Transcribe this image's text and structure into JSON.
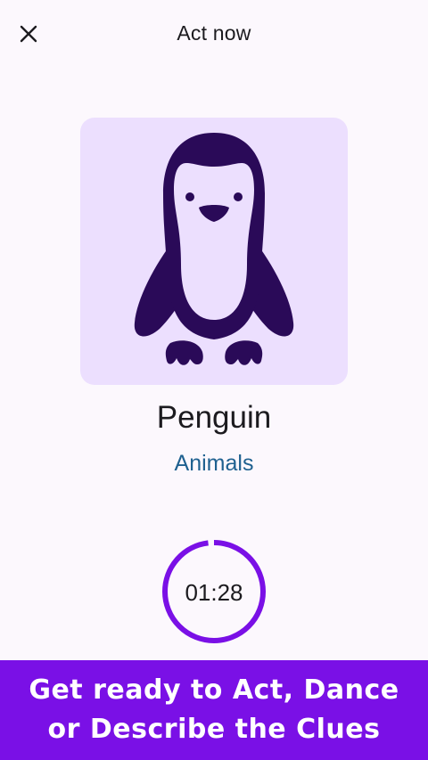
{
  "header": {
    "title": "Act now",
    "close_icon": "close-icon"
  },
  "card": {
    "image_icon": "penguin-icon",
    "colors": {
      "card_background": "#ecdffe",
      "icon_fill": "#2a0a58"
    }
  },
  "word": "Penguin",
  "category": "Animals",
  "timer": {
    "time": "01:28",
    "progress": 0.98,
    "ring_color": "#7a10e6"
  },
  "banner": {
    "line1": "Get ready to Act, Dance",
    "line2": "or Describe the Clues",
    "background": "#7a10e6"
  }
}
